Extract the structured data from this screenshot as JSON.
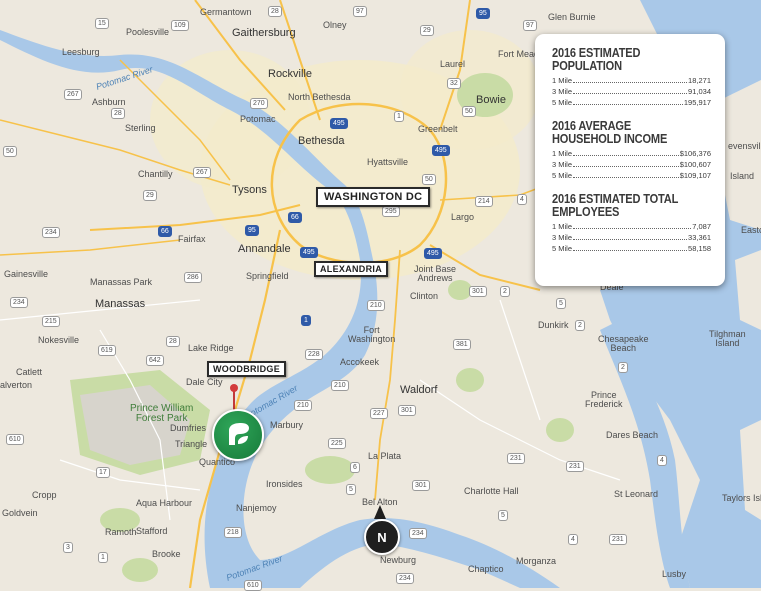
{
  "map": {
    "places": {
      "germantown": "Germantown",
      "olney": "Olney",
      "poolesville": "Poolesville",
      "gaithersburg": "Gaithersburg",
      "laurel": "Laurel",
      "fort_meade": "Fort Meade",
      "glen_burnie": "Glen Burnie",
      "leesburg": "Leesburg",
      "ashburn": "Ashburn",
      "rockville": "Rockville",
      "north_bethesda": "North Bethesda",
      "potomac": "Potomac",
      "bethesda": "Bethesda",
      "greenbelt": "Greenbelt",
      "bowie": "Bowie",
      "sterling": "Sterling",
      "hyattsville": "Hyattsville",
      "chantilly": "Chantilly",
      "tysons": "Tysons",
      "fairfax": "Fairfax",
      "annandale": "Annandale",
      "largo": "Largo",
      "gainesville": "Gainesville",
      "springfield": "Springfield",
      "joint_base_andrews": "Joint Base\nAndrews",
      "manassas_park": "Manassas Park",
      "manassas": "Manassas",
      "clinton": "Clinton",
      "nokesville": "Nokesville",
      "fort_washington": "Fort\nWashington",
      "lake_ridge": "Lake Ridge",
      "accokeek": "Accokeek",
      "catlett": "Catlett",
      "dale_city": "Dale City",
      "waldorf": "Waldorf",
      "alverton": "alverton",
      "dumfries": "Dumfries",
      "marbury": "Marbury",
      "triangle": "Triangle",
      "quantico": "Quantico",
      "la_plata": "La Plata",
      "ironsides": "Ironsides",
      "charlotte_hall": "Charlotte Hall",
      "cropp": "Cropp",
      "aqua_harbour": "Aqua Harbour",
      "goldvein": "Goldvein",
      "nanjemoy": "Nanjemoy",
      "ramoth": "Ramoth",
      "stafford": "Stafford",
      "bel_alton": "Bel Alton",
      "brooke": "Brooke",
      "newburg": "Newburg",
      "morganza": "Morganza",
      "chaptico": "Chaptico",
      "dunkirk": "Dunkirk",
      "chesapeake_beach": "Chesapeake\nBeach",
      "prince_frederick": "Prince\nFrederick",
      "dares_beach": "Dares Beach",
      "st_leonard": "St Leonard",
      "lusby": "Lusby",
      "tilghman_island": "Tilghman\nIsland",
      "taylors_island": "Taylors Isla",
      "deale": "Deale",
      "stevensville": "evensville",
      "kent_island": "Island",
      "easton": "Easto"
    },
    "parks": {
      "prince_william": "Prince William\nForest Park"
    },
    "water": {
      "potomac_nw": "Potomac River",
      "potomac_mid": "Potomac River",
      "potomac_south": "Potomac River"
    },
    "callouts": {
      "washington_dc": "WASHINGTON DC",
      "alexandria": "ALEXANDRIA",
      "woodbridge": "WOODBRIDGE"
    },
    "shields": [
      "15",
      "109",
      "28",
      "97",
      "95",
      "29",
      "32",
      "97",
      "267",
      "270",
      "495",
      "50",
      "1",
      "50",
      "495",
      "28",
      "267",
      "95",
      "66",
      "495",
      "295",
      "214",
      "50",
      "29",
      "4",
      "66",
      "234",
      "286",
      "495",
      "210",
      "301",
      "2",
      "234",
      "215",
      "5",
      "619",
      "28",
      "642",
      "228",
      "210",
      "210",
      "381",
      "2",
      "610",
      "1",
      "231",
      "6",
      "225",
      "227",
      "5",
      "301",
      "301",
      "231",
      "2",
      "4",
      "17",
      "1",
      "3",
      "218",
      "234",
      "4",
      "5",
      "231",
      "610",
      "234"
    ],
    "compass": "N",
    "colors": {
      "water": "#a9c8e8",
      "land": "#ede8de",
      "park": "#c7dca2",
      "urban": "#f1e8c7",
      "highway": "#f7c24a",
      "pin_green": "#1f8f46",
      "pin_red": "#d33b3b"
    }
  },
  "stats": {
    "population": {
      "title": "2016 Estimated Population",
      "rows": [
        {
          "label": "1 Mile",
          "value": "18,271"
        },
        {
          "label": "3 Mile",
          "value": "91,034"
        },
        {
          "label": "5 Mile",
          "value": "195,917"
        }
      ]
    },
    "income": {
      "title": "2016 Average Household Income",
      "rows": [
        {
          "label": "1 Mile",
          "value": "$106,376"
        },
        {
          "label": "3 Mile",
          "value": "$100,607"
        },
        {
          "label": "5 Mile",
          "value": "$109,107"
        }
      ]
    },
    "employees": {
      "title": "2016 Estimated Total Employees",
      "rows": [
        {
          "label": "1 Mile",
          "value": "7,087"
        },
        {
          "label": "3 Mile",
          "value": "33,361"
        },
        {
          "label": "5 Mile",
          "value": "58,158"
        }
      ]
    }
  }
}
